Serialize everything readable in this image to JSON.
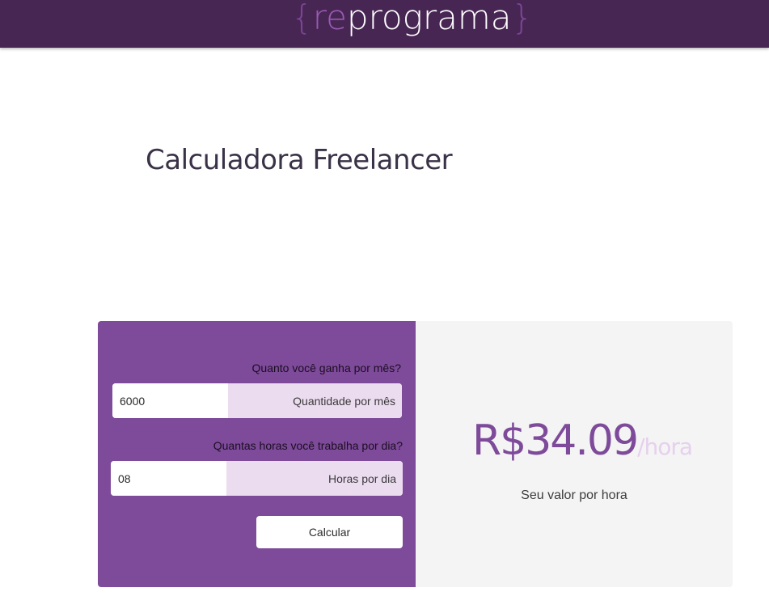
{
  "header": {
    "logo": {
      "brace_open": "{",
      "prefix": "re",
      "suffix": "programa",
      "brace_close": "}"
    }
  },
  "page": {
    "title": "Calculadora Freelancer"
  },
  "form": {
    "monthly_income": {
      "label": "Quanto você ganha por mês?",
      "value": "6000",
      "addon": "Quantidade por mês"
    },
    "hours_per_day": {
      "label": "Quantas horas você trabalha por dia?",
      "value": "08",
      "addon": "Horas por dia"
    },
    "submit_label": "Calcular"
  },
  "result": {
    "amount": "R$34.09",
    "unit": "/hora",
    "caption": "Seu valor por hora"
  },
  "colors": {
    "header_bg": "#482654",
    "brand_purple": "#7e4a9a",
    "addon_bg": "#ecdcf0",
    "result_bg": "#f4f4f4",
    "unit_color": "#e6d0ee"
  }
}
